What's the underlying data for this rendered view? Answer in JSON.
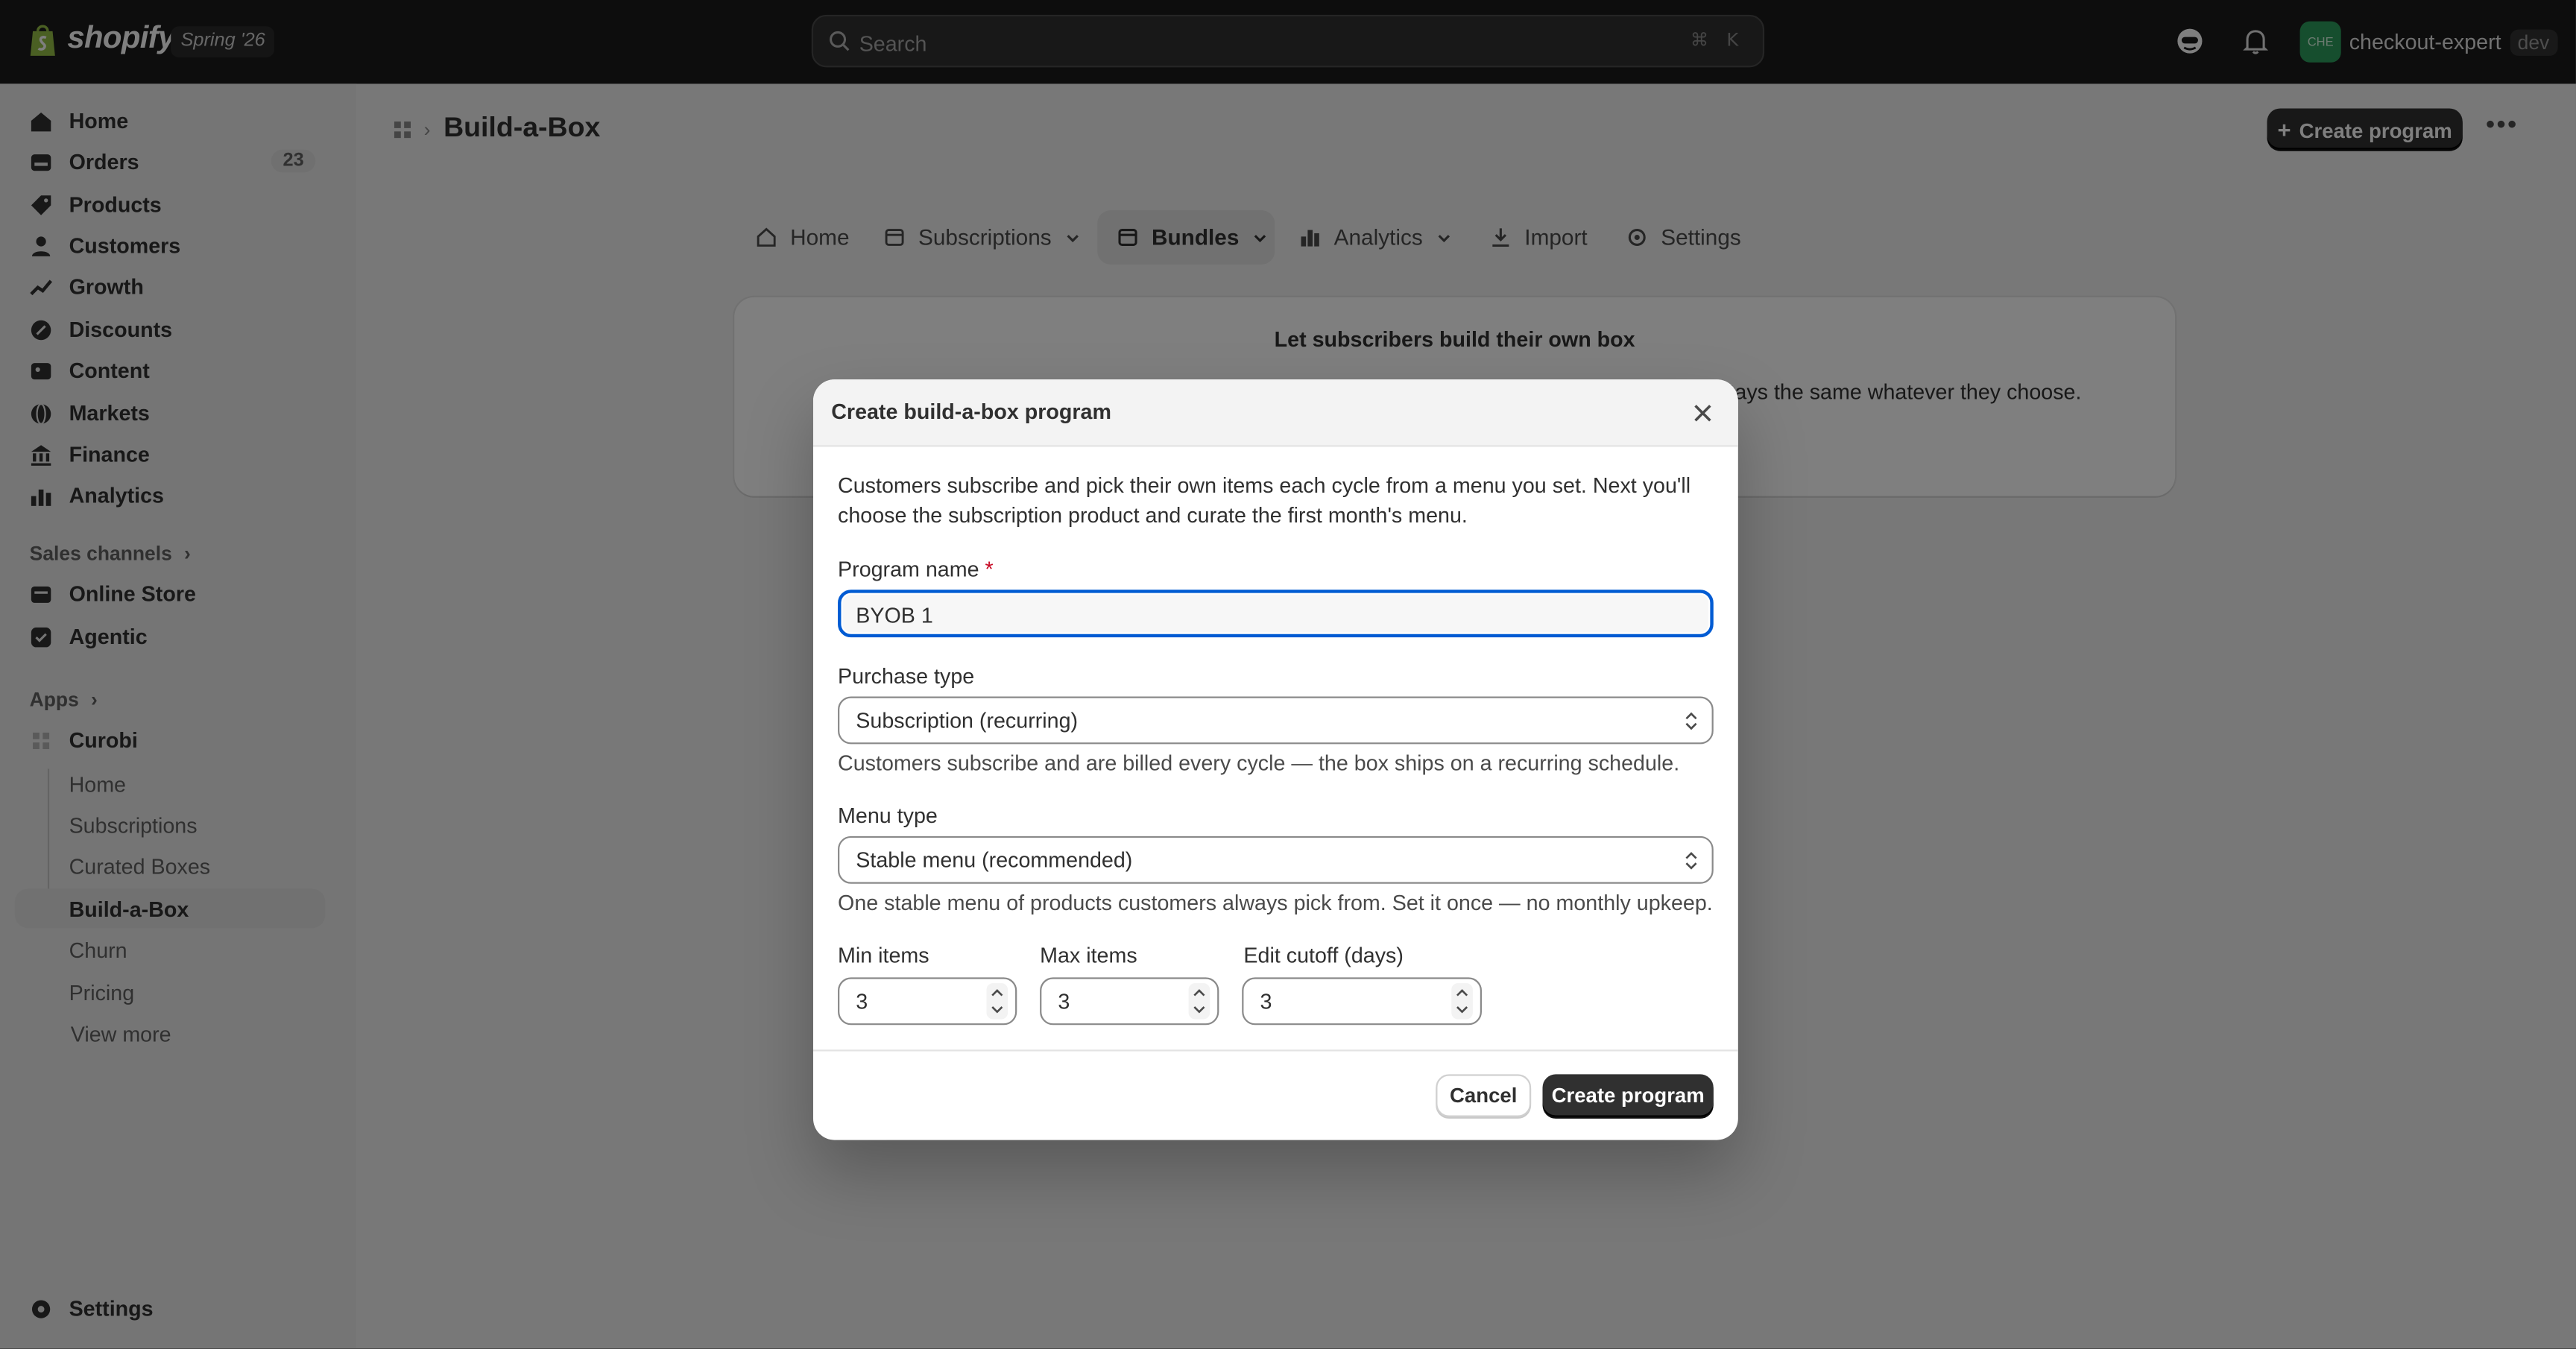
{
  "topbar": {
    "brand": "shopify",
    "edition": "Spring '26",
    "search_placeholder": "Search",
    "shortcut_1": "⌘",
    "shortcut_2": "K",
    "account_initials": "CHE",
    "account_name": "checkout-expert",
    "account_tag": "dev",
    "avatar_color": "#2d9d5c"
  },
  "sidebar": {
    "items": [
      {
        "label": "Home",
        "icon": "home-icon"
      },
      {
        "label": "Orders",
        "icon": "orders-icon",
        "badge": "23"
      },
      {
        "label": "Products",
        "icon": "tag-icon"
      },
      {
        "label": "Customers",
        "icon": "person-icon"
      },
      {
        "label": "Growth",
        "icon": "growth-icon"
      },
      {
        "label": "Discounts",
        "icon": "discount-icon"
      },
      {
        "label": "Content",
        "icon": "content-icon"
      },
      {
        "label": "Markets",
        "icon": "globe-icon"
      },
      {
        "label": "Finance",
        "icon": "bank-icon"
      },
      {
        "label": "Analytics",
        "icon": "chart-icon"
      }
    ],
    "sales_channels_label": "Sales channels",
    "channels": [
      {
        "label": "Online Store",
        "icon": "store-icon"
      },
      {
        "label": "Agentic",
        "icon": "agentic-icon"
      }
    ],
    "apps_label": "Apps",
    "app_name": "Curobi",
    "app_items": [
      "Home",
      "Subscriptions",
      "Curated Boxes",
      "Build-a-Box",
      "Churn",
      "Pricing"
    ],
    "view_more": "View more",
    "settings": "Settings"
  },
  "page": {
    "title": "Build-a-Box",
    "create_button": "Create program",
    "more_button": "•••"
  },
  "tabs": [
    {
      "label": "Home",
      "icon": "home-icon"
    },
    {
      "label": "Subscriptions",
      "icon": "subscriptions-icon"
    },
    {
      "label": "Bundles",
      "icon": "bundles-icon"
    },
    {
      "label": "Analytics",
      "icon": "analytics-icon"
    },
    {
      "label": "Import",
      "icon": "import-icon"
    },
    {
      "label": "Settings",
      "icon": "settings-icon"
    }
  ],
  "card": {
    "title": "Let subscribers build their own box",
    "text_fragment": "stays the same whatever they choose."
  },
  "modal": {
    "title": "Create build-a-box program",
    "description": "Customers subscribe and pick their own items each cycle from a menu you set. Next you'll choose the subscription product and curate the first month's menu.",
    "program_name_label": "Program name",
    "required_mark": "*",
    "program_name_value": "BYOB 1",
    "purchase_type_label": "Purchase type",
    "purchase_type_value": "Subscription (recurring)",
    "purchase_type_help": "Customers subscribe and are billed every cycle — the box ships on a recurring schedule.",
    "menu_type_label": "Menu type",
    "menu_type_value": "Stable menu (recommended)",
    "menu_type_help": "One stable menu of products customers always pick from. Set it once — no monthly upkeep.",
    "min_items_label": "Min items",
    "min_items_value": "3",
    "max_items_label": "Max items",
    "max_items_value": "3",
    "edit_cutoff_label": "Edit cutoff (days)",
    "edit_cutoff_value": "3",
    "cancel": "Cancel",
    "submit": "Create program"
  },
  "colors": {
    "focus_ring": "#005bd3",
    "primary_button": "#303030",
    "required": "#c70a24"
  }
}
